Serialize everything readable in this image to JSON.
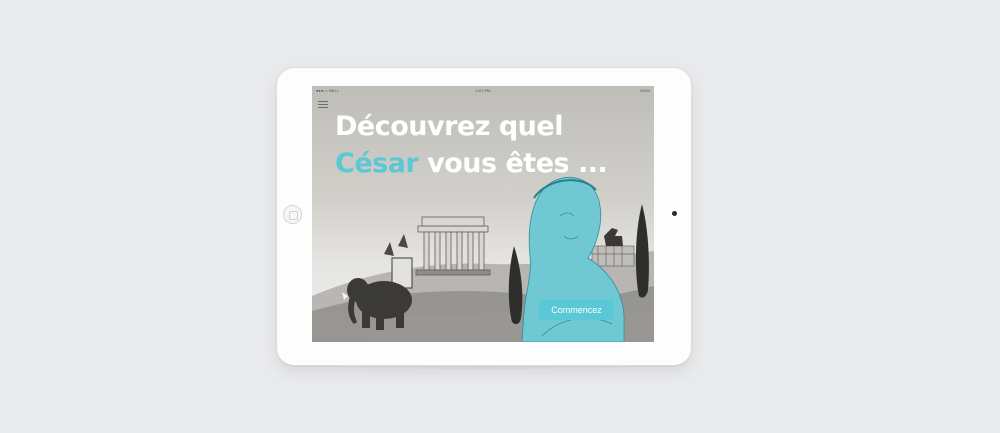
{
  "status_bar": {
    "carrier": "●●●○○ BELL",
    "time": "4:21 PM",
    "battery": "100%"
  },
  "menu": {
    "icon": "hamburger-menu-icon"
  },
  "headline": {
    "line1": "Découvrez quel",
    "accent_word": "César",
    "line2_rest": " vous êtes ..."
  },
  "cta": {
    "label": "Commencez"
  },
  "colors": {
    "accent": "#5bc8d6",
    "headline_text": "#ffffff",
    "page_background": "#e9eaec",
    "device_body": "#fdfdfd"
  }
}
